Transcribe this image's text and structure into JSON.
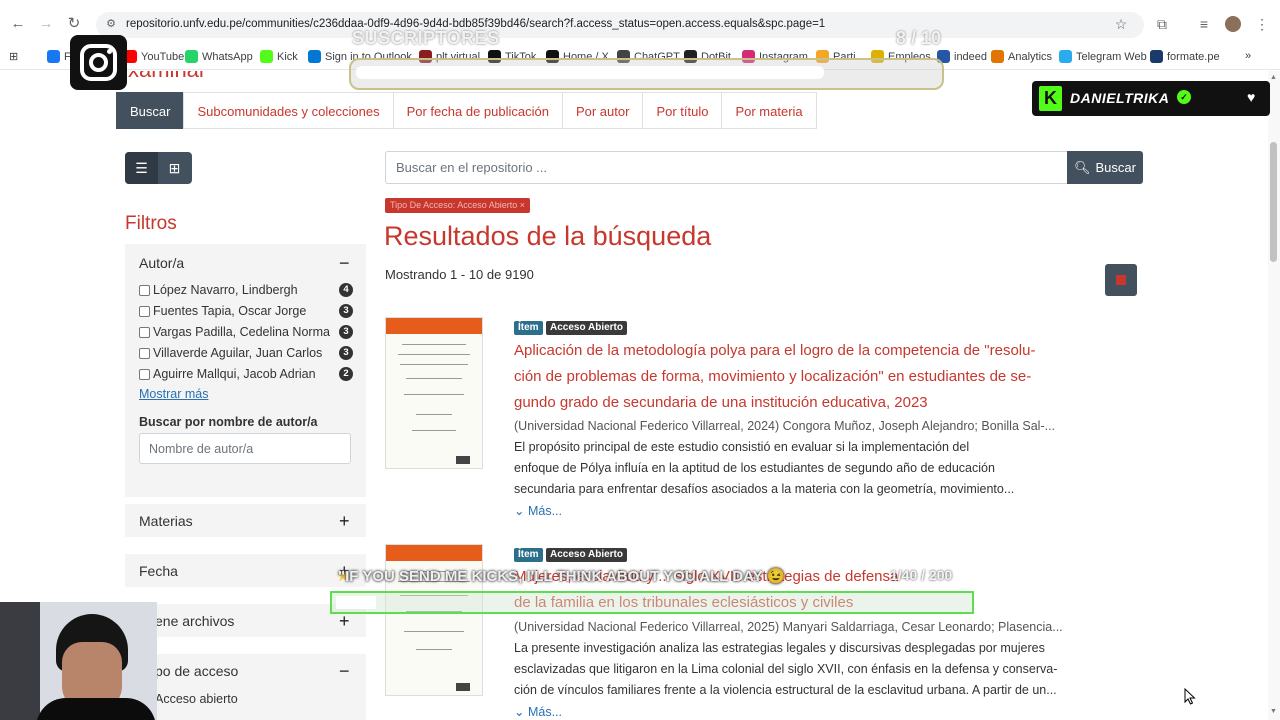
{
  "browser": {
    "url": "repositorio.unfv.edu.pe/communities/c236ddaa-0df9-4d96-9d4d-bdb85f39bd46/search?f.access_status=open.access.equals&spc.page=1",
    "bookmarks": [
      {
        "label": "F",
        "icon_color": "#1877f2"
      },
      {
        "label": "YouTube",
        "icon_color": "#ff0000"
      },
      {
        "label": "WhatsApp",
        "icon_color": "#25d366"
      },
      {
        "label": "Kick",
        "icon_color": "#53fc18"
      },
      {
        "label": "Sign in to Outlook",
        "icon_color": "#0078d4"
      },
      {
        "label": "plt virtual",
        "icon_color": "#8a1f1f"
      },
      {
        "label": "TikTok",
        "icon_color": "#111111"
      },
      {
        "label": "Home / X",
        "icon_color": "#111111"
      },
      {
        "label": "ChatGPT",
        "icon_color": "#444444"
      },
      {
        "label": "DotBit",
        "icon_color": "#222222"
      },
      {
        "label": "Instagram",
        "icon_color": "#d62976"
      },
      {
        "label": "Parti",
        "icon_color": "#f5a623"
      },
      {
        "label": "Empleos",
        "icon_color": "#e0b000"
      },
      {
        "label": "indeed",
        "icon_color": "#2557a7"
      },
      {
        "label": "Analytics",
        "icon_color": "#e37400"
      },
      {
        "label": "Telegram Web",
        "icon_color": "#2aabee"
      },
      {
        "label": "formate.pe",
        "icon_color": "#1a3a6b"
      }
    ]
  },
  "header": {
    "partial_title": "xaminar"
  },
  "tabs": [
    {
      "label": "Buscar",
      "active": true
    },
    {
      "label": "Subcomunidades y colecciones"
    },
    {
      "label": "Por fecha de publicación"
    },
    {
      "label": "Por autor"
    },
    {
      "label": "Por título"
    },
    {
      "label": "Por materia"
    }
  ],
  "search": {
    "placeholder": "Buscar en el repositorio ...",
    "button_label": "Buscar"
  },
  "filter_badge": "Tipo De Acceso: Acceso Abierto ×",
  "results_title": "Resultados de la búsqueda",
  "showing_text": "Mostrando 1 - 10 de 9190",
  "sidebar": {
    "title": "Filtros",
    "autor": {
      "title": "Autor/a",
      "authors": [
        {
          "name": "López Navarro, Lindbergh",
          "count": "4"
        },
        {
          "name": "Fuentes Tapia, Oscar Jorge",
          "count": "3"
        },
        {
          "name": "Vargas Padilla, Cedelina Norma",
          "count": "3"
        },
        {
          "name": "Villaverde Aguilar, Juan Carlos",
          "count": "3"
        },
        {
          "name": "Aguirre Mallqui, Jacob Adrian",
          "count": "2"
        }
      ],
      "show_more": "Mostrar más",
      "search_label": "Buscar por nombre de autor/a",
      "search_placeholder": "Nombre de autor/a"
    },
    "materias": "Materias",
    "fecha": "Fecha",
    "archivos": "ene archivos",
    "acceso": "po de acceso",
    "acceso_item": "Acceso abierto"
  },
  "results": [
    {
      "type": "Ítem",
      "access": "Acceso Abierto",
      "title_lines": [
        "Aplicación de la metodología polya para el logro de la competencia de \"resolu-",
        "ción de problemas de forma, movimiento y localización\" en estudiantes de se-",
        "gundo grado de secundaria de una institución educativa, 2023"
      ],
      "meta": "(Universidad Nacional Federico Villarreal, 2024) Congora Muñoz, Joseph Alejandro; Bonilla Sal-...",
      "abstract_lines": [
        "El propósito principal de este estudio consistió en evaluar si la implementación del",
        "enfoque de Pólya influía en la aptitud de los estudiantes de segundo año de educación",
        "secundaria para enfrentar desafíos asociados a la materia con la geometría, movimiento..."
      ],
      "more": "Más..."
    },
    {
      "type": "Ítem",
      "access": "Acceso Abierto",
      "title_lines": [
        "Mujeres, esclavitud y ... siglo XVII: estrategias de defensa",
        "de la familia en los tribunales eclesiásticos y civiles"
      ],
      "meta": "(Universidad Nacional Federico Villarreal, 2025) Manyari Saldarriaga, Cesar Leonardo; Plasencia...",
      "abstract_lines": [
        "La presente investigación analiza las estrategias legales y discursivas desplegadas por mujeres",
        "esclavizadas que litigaron en la Lima colonial del siglo XVII, con énfasis en la defensa y conserva-",
        "ción de vínculos familiares frente a la violencia estructural de la esclavitud urbana. A partir de un..."
      ],
      "more": "Más..."
    }
  ],
  "overlay": {
    "subs_label": "SUSCRIPTORES",
    "subs_count": "8 / 10",
    "subs_progress": 0.8,
    "kick_name": "DANIELTRIKA",
    "tts_text": "\"IF YOU SEND ME KICKS, I'LL THINK ABOUT YOU ALL DAY 😉",
    "tts_count": "1/40 / 200",
    "colors": {
      "kick_green": "#53fc18",
      "brand_red": "#c8372d",
      "nav_dark": "#43515f"
    }
  }
}
